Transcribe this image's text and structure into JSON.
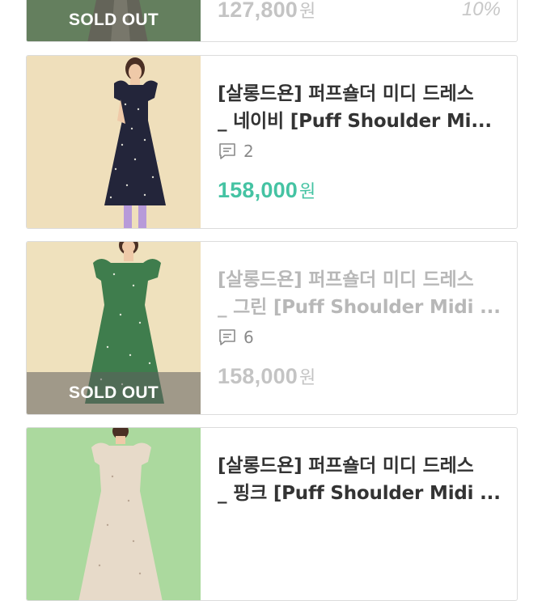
{
  "products": [
    {
      "title_line1": "",
      "title_line2": "",
      "comments": "",
      "price": "127,800",
      "currency": "원",
      "discount": "10%",
      "sold_out_label": "SOLD OUT",
      "colors": {
        "bg": "#6aa65d"
      }
    },
    {
      "title_line1": "[살롱드욘] 퍼프숄더 미디 드레스",
      "title_line2": "_ 네이비 [Puff Shoulder Mi...",
      "comments": "2",
      "price": "158,000",
      "currency": "원",
      "colors": {
        "bg": "#eeddb8",
        "dress": "#222436"
      }
    },
    {
      "title_line1": "[살롱드욘] 퍼프숄더 미디 드레스",
      "title_line2": "_ 그린 [Puff Shoulder Midi ...",
      "comments": "6",
      "price": "158,000",
      "currency": "원",
      "sold_out_label": "SOLD OUT",
      "colors": {
        "bg": "#efe1bd",
        "dress": "#3e7d4c"
      }
    },
    {
      "title_line1": "[살롱드욘] 퍼프숄더 미디 드레스",
      "title_line2": "_ 핑크 [Puff Shoulder Midi ...",
      "colors": {
        "bg": "#a8d89a",
        "dress": "#e6d8c8"
      }
    }
  ],
  "accent_color": "#45c3a3",
  "icons": {
    "comment": "speech-bubble-icon"
  }
}
